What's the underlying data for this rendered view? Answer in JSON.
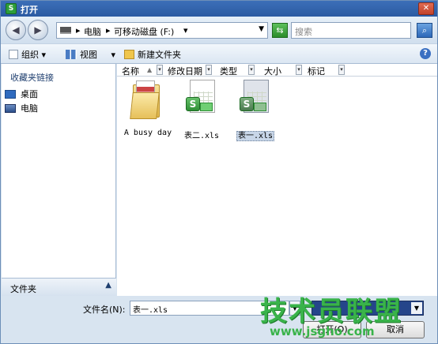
{
  "window": {
    "title": "打开"
  },
  "address": {
    "crumbs": [
      "电脑",
      "可移动磁盘 (F:)"
    ],
    "separator": "▸"
  },
  "search": {
    "placeholder": "搜索"
  },
  "toolbar": {
    "organize": "组织",
    "view": "视图",
    "new_folder": "新建文件夹"
  },
  "sidebar": {
    "heading": "收藏夹链接",
    "items": [
      {
        "label": "桌面",
        "icon": "desktop-icon"
      },
      {
        "label": "电脑",
        "icon": "computer-icon"
      }
    ],
    "folders_label": "文件夹"
  },
  "columns": [
    "名称",
    "修改日期",
    "类型",
    "大小",
    "标记"
  ],
  "files": [
    {
      "name": "A busy day",
      "icon": "folder-icon",
      "selected": false
    },
    {
      "name": "表二.xls",
      "icon": "spreadsheet-icon",
      "selected": false
    },
    {
      "name": "表一.xls",
      "icon": "spreadsheet-icon",
      "selected": true
    }
  ],
  "bottom": {
    "filename_label": "文件名(N):",
    "filename_value": "表一.xls",
    "filetype_value": "",
    "open_button": "打开(O)",
    "cancel_button": "取消"
  },
  "watermark": {
    "text": "技术员联盟",
    "url": "www.jsgho.com"
  },
  "colors": {
    "title_bar": "#2b5aa2",
    "selection": "#c8d6e8",
    "watermark_green": "#39b34a"
  }
}
